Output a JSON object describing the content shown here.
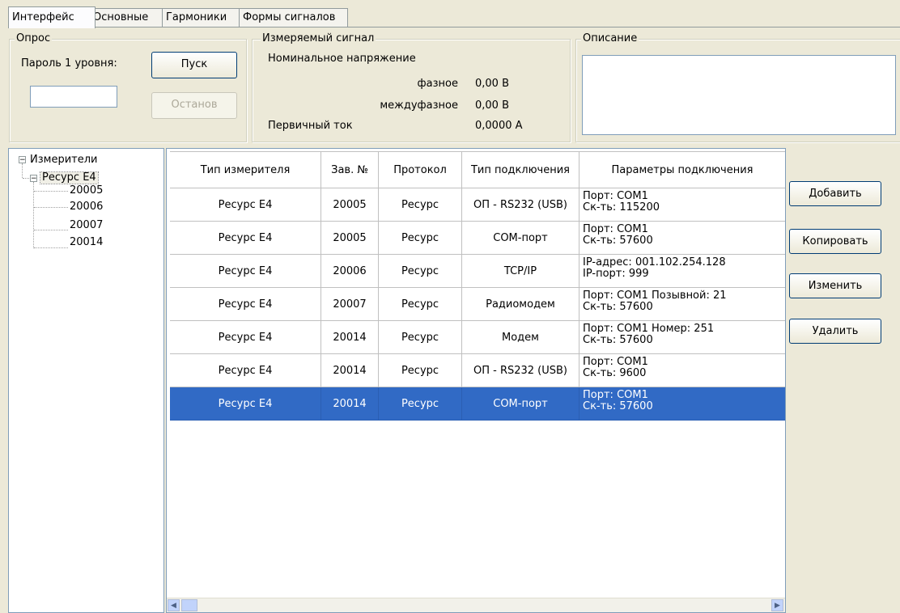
{
  "tabs": [
    {
      "label": "Интерфейс"
    },
    {
      "label": "Основные"
    },
    {
      "label": "Гармоники"
    },
    {
      "label": "Формы сигналов"
    }
  ],
  "polling": {
    "title": "Опрос",
    "password_label": "Пароль 1 уровня:",
    "password_value": "",
    "start_label": "Пуск",
    "stop_label": "Останов"
  },
  "signal": {
    "title": "Измеряемый сигнал",
    "nominal_voltage": "Номинальное напряжение",
    "phase_label": "фазное",
    "phase_value": "0,00 В",
    "linear_label": "междуфазное",
    "linear_value": "0,00 В",
    "primary_current_label": "Первичный ток",
    "primary_current_value": "0,0000 А"
  },
  "description": {
    "title": "Описание",
    "value": ""
  },
  "tree": {
    "root": "Измерители",
    "device": "Ресурс Е4",
    "children": [
      "20005",
      "20006",
      "20007",
      "20014"
    ]
  },
  "grid": {
    "headers": [
      "Тип измерителя",
      "Зав. №",
      "Протокол",
      "Тип подключения",
      "Параметры подключения"
    ],
    "rows": [
      {
        "type": "Ресурс Е4",
        "serial": "20005",
        "protocol": "Ресурс",
        "conn": "ОП - RS232 (USB)",
        "p1": "Порт:  COM1",
        "p2": "Ск-ть:  115200"
      },
      {
        "type": "Ресурс Е4",
        "serial": "20005",
        "protocol": "Ресурс",
        "conn": "COM-порт",
        "p1": "Порт:  COM1",
        "p2": "Ск-ть:  57600"
      },
      {
        "type": "Ресурс Е4",
        "serial": "20006",
        "protocol": "Ресурс",
        "conn": "TCP/IP",
        "p1": "IP-адрес:  001.102.254.128",
        "p2": "IP-порт:   999"
      },
      {
        "type": "Ресурс Е4",
        "serial": "20007",
        "protocol": "Ресурс",
        "conn": "Радиомодем",
        "p1": "Порт:  COM1      Позывной:  21",
        "p2": "Ск-ть:  57600"
      },
      {
        "type": "Ресурс Е4",
        "serial": "20014",
        "protocol": "Ресурс",
        "conn": "Модем",
        "p1": "Порт:  COM1      Номер:  251",
        "p2": "Ск-ть:  57600"
      },
      {
        "type": "Ресурс Е4",
        "serial": "20014",
        "protocol": "Ресурс",
        "conn": "ОП - RS232 (USB)",
        "p1": "Порт:  COM1",
        "p2": "Ск-ть:  9600"
      },
      {
        "type": "Ресурс Е4",
        "serial": "20014",
        "protocol": "Ресурс",
        "conn": "COM-порт",
        "p1": "Порт:  COM1",
        "p2": "Ск-ть:  57600"
      }
    ],
    "selected_row": 6
  },
  "actions": {
    "add": "Добавить",
    "copy": "Копировать",
    "edit": "Изменить",
    "delete": "Удалить"
  },
  "colors": {
    "background": "#ece9d8",
    "selection": "#316ac5"
  }
}
